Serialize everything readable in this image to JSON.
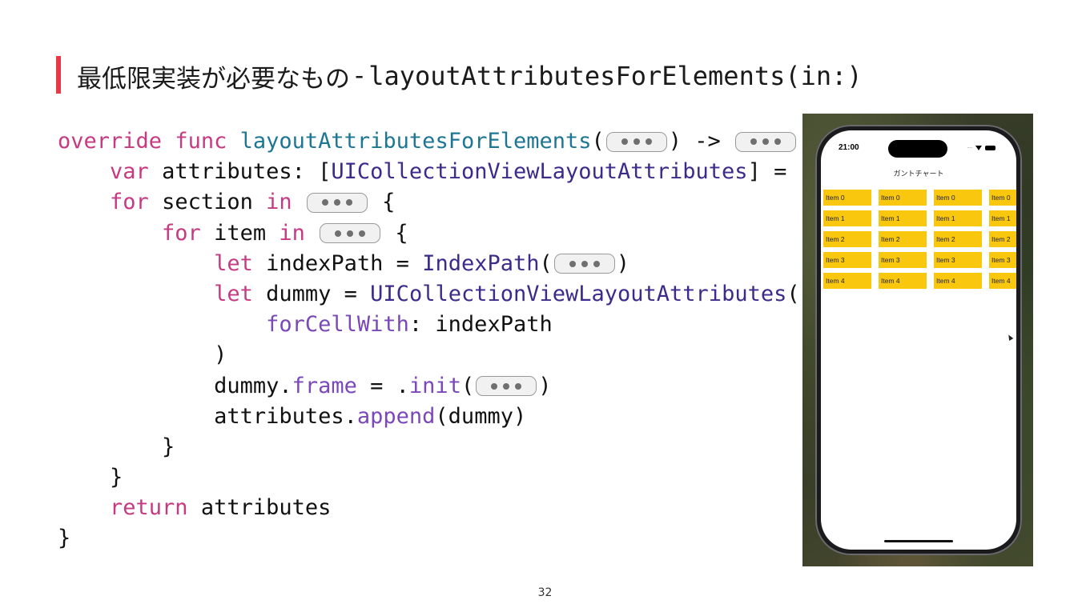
{
  "title": {
    "jp": "最低限実装が必要なもの",
    "separator": "-",
    "method": "layoutAttributesForElements(in:)"
  },
  "code": [
    [
      {
        "t": "override",
        "c": "kw"
      },
      {
        "t": " "
      },
      {
        "t": "func",
        "c": "kw"
      },
      {
        "t": " "
      },
      {
        "t": "layoutAttributesForElements",
        "c": "fn"
      },
      {
        "t": "("
      },
      {
        "pill": true
      },
      {
        "t": ") -> "
      },
      {
        "pill": true
      },
      {
        "t": " {"
      }
    ],
    [
      {
        "t": "    "
      },
      {
        "t": "var",
        "c": "kw"
      },
      {
        "t": " attributes: ["
      },
      {
        "t": "UICollectionViewLayoutAttributes",
        "c": "ty"
      },
      {
        "t": "] = []"
      }
    ],
    [
      {
        "t": "    "
      },
      {
        "t": "for",
        "c": "kw"
      },
      {
        "t": " section "
      },
      {
        "t": "in",
        "c": "kw"
      },
      {
        "t": " "
      },
      {
        "pill": true
      },
      {
        "t": " {"
      }
    ],
    [
      {
        "t": "        "
      },
      {
        "t": "for",
        "c": "kw"
      },
      {
        "t": " item "
      },
      {
        "t": "in",
        "c": "kw"
      },
      {
        "t": " "
      },
      {
        "pill": true
      },
      {
        "t": " {"
      }
    ],
    [
      {
        "t": "            "
      },
      {
        "t": "let",
        "c": "kw"
      },
      {
        "t": " indexPath = "
      },
      {
        "t": "IndexPath",
        "c": "ty"
      },
      {
        "t": "("
      },
      {
        "pill": true
      },
      {
        "t": ")"
      }
    ],
    [
      {
        "t": "            "
      },
      {
        "t": "let",
        "c": "kw"
      },
      {
        "t": " dummy = "
      },
      {
        "t": "UICollectionViewLayoutAttributes",
        "c": "ty"
      },
      {
        "t": "("
      }
    ],
    [
      {
        "t": "                "
      },
      {
        "t": "forCellWith",
        "c": "pr"
      },
      {
        "t": ": indexPath"
      }
    ],
    [
      {
        "t": "            )"
      }
    ],
    [
      {
        "t": "            dummy."
      },
      {
        "t": "frame",
        "c": "pr"
      },
      {
        "t": " = ."
      },
      {
        "t": "init",
        "c": "pr"
      },
      {
        "t": "("
      },
      {
        "pill": true
      },
      {
        "t": ")"
      }
    ],
    [
      {
        "t": "            attributes."
      },
      {
        "t": "append",
        "c": "pr"
      },
      {
        "t": "(dummy)"
      }
    ],
    [
      {
        "t": "        }"
      }
    ],
    [
      {
        "t": "    }"
      }
    ],
    [
      {
        "t": "    "
      },
      {
        "t": "return",
        "c": "kw"
      },
      {
        "t": " attributes"
      }
    ],
    [
      {
        "t": "}"
      }
    ]
  ],
  "simulator": {
    "time": "21:00",
    "nav_title": "ガントチャート",
    "columns": [
      [
        "Item 0",
        "Item 1",
        "Item 2",
        "Item 3",
        "Item 4"
      ],
      [
        "Item 0",
        "Item 1",
        "Item 2",
        "Item 3",
        "Item 4"
      ],
      [
        "Item 0",
        "Item 1",
        "Item 2",
        "Item 3",
        "Item 4"
      ],
      [
        "Item 0",
        "Item 1",
        "Item 2",
        "Item 3",
        "Item 4"
      ]
    ],
    "cell_color": "#f9c80e"
  },
  "page_number": "32",
  "colors": {
    "accent_bar": "#e8394a",
    "keyword": "#c73a82",
    "function": "#1d7694",
    "type": "#3d2a8a",
    "property": "#7a48b8"
  }
}
